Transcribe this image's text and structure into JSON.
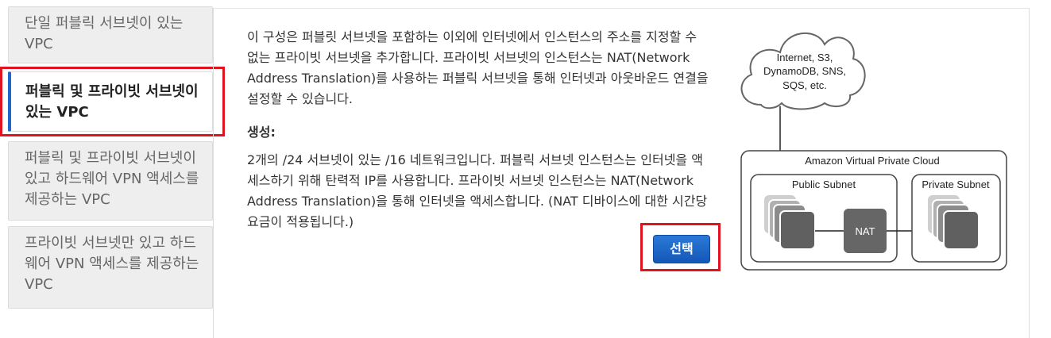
{
  "sidebar": {
    "items": [
      {
        "label": "단일 퍼블릭 서브넷이 있는 VPC"
      },
      {
        "label": "퍼블릭 및 프라이빗 서브넷이 있는 VPC"
      },
      {
        "label": "퍼블릭 및 프라이빗 서브넷이 있고 하드웨어 VPN 액세스를 제공하는 VPC"
      },
      {
        "label": "프라이빗 서브넷만 있고 하드웨어 VPN 액세스를 제공하는 VPC"
      }
    ]
  },
  "main": {
    "description": "이 구성은 퍼블릿 서브넷을 포함하는 이외에 인터넷에서 인스턴스의 주소를 지정할 수 없는 프라이빗 서브넷을 추가합니다. 프라이빗 서브넷의 인스턴스는 NAT(Network Address Translation)를 사용하는 퍼블릭 서브넷을 통해 인터넷과 아웃바운드 연결을 설정할 수 있습니다.",
    "creates_label": "생성:",
    "creates_text": "2개의 /24 서브넷이 있는 /16 네트워크입니다. 퍼블릭 서브넷 인스턴스는 인터넷을 액세스하기 위해 탄력적 IP를 사용합니다. 프라이빗 서브넷 인스턴스는 NAT(Network Address Translation)을 통해 인터넷을 액세스합니다. (NAT 디바이스에 대한 시간당 요금이 적용됩니다.)",
    "select_button": "선택"
  },
  "diagram": {
    "cloud_lines": [
      "Internet, S3,",
      "DynamoDB, SNS,",
      "SQS, etc."
    ],
    "vpc_label": "Amazon Virtual Private Cloud",
    "public_subnet": "Public Subnet",
    "private_subnet": "Private Subnet",
    "nat_label": "NAT"
  },
  "colors": {
    "accent": "#1f67c9",
    "highlight": "#e0141e",
    "button": "#1a63c6"
  }
}
